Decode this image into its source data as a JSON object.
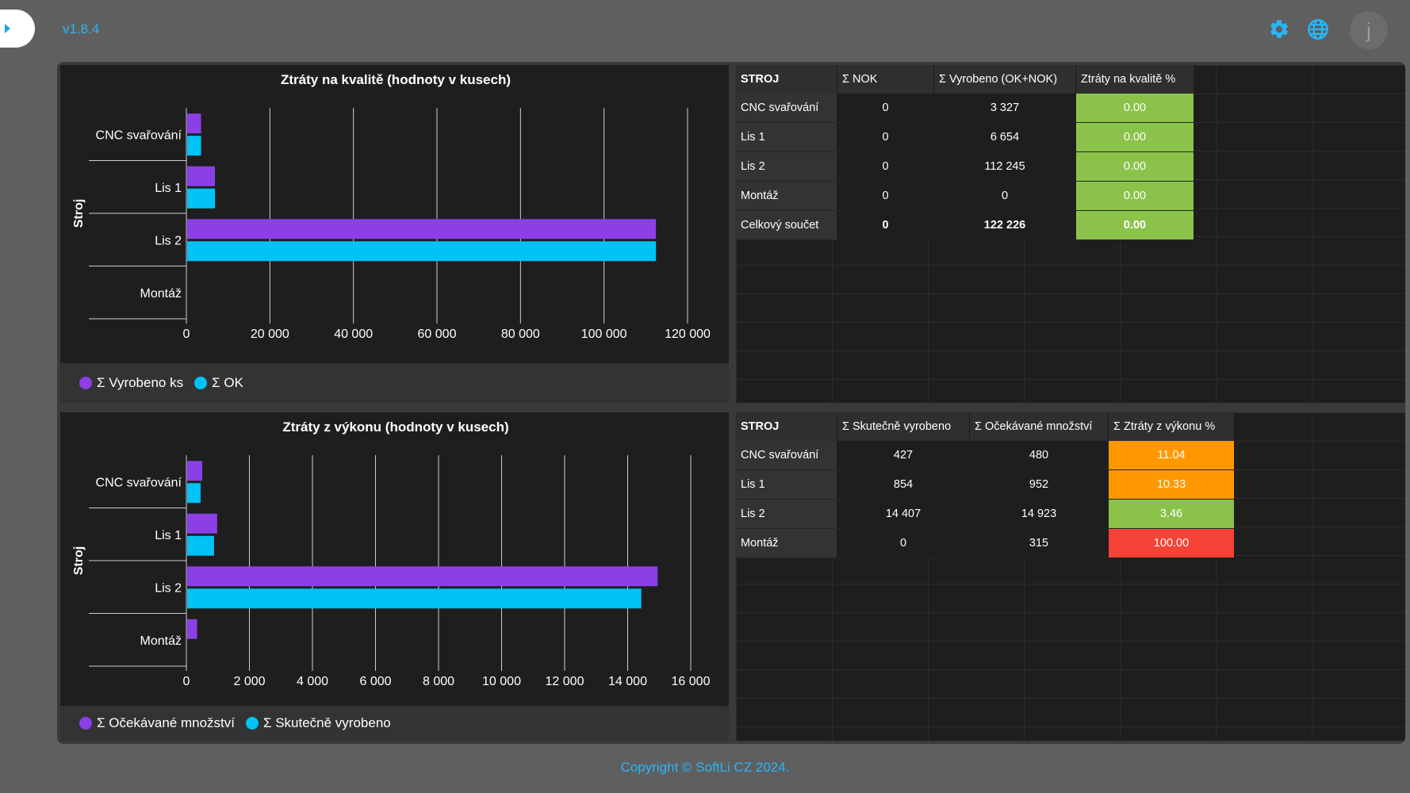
{
  "header": {
    "version": "v1.8.4",
    "avatar_letter": "j"
  },
  "charts": [
    {
      "title": "Ztráty na kvalitě (hodnoty v kusech)",
      "ylabel": "Stroj",
      "categories": [
        "CNC svařování",
        "Lis 1",
        "Lis 2",
        "Montáž"
      ],
      "xmax": 120000,
      "ticks": [
        0,
        20000,
        40000,
        60000,
        80000,
        100000,
        120000
      ],
      "series": [
        {
          "name": "Σ Vyrobeno ks",
          "color": "#8c3fe6",
          "values": [
            3327,
            6654,
            112245,
            0
          ]
        },
        {
          "name": "Σ OK",
          "color": "#00c2f5",
          "values": [
            3327,
            6654,
            112245,
            0
          ]
        }
      ]
    },
    {
      "title": "Ztráty z výkonu (hodnoty v kusech)",
      "ylabel": "Stroj",
      "categories": [
        "CNC svařování",
        "Lis 1",
        "Lis 2",
        "Montáž"
      ],
      "xmax": 16000,
      "ticks": [
        0,
        2000,
        4000,
        6000,
        8000,
        10000,
        12000,
        14000,
        16000
      ],
      "series": [
        {
          "name": "Σ Očekávané množství",
          "color": "#8c3fe6",
          "values": [
            480,
            952,
            14923,
            315
          ]
        },
        {
          "name": "Σ Skutečně vyrobeno",
          "color": "#00c2f5",
          "values": [
            427,
            854,
            14407,
            0
          ]
        }
      ]
    }
  ],
  "quality_table": {
    "headers": [
      "STROJ",
      "Σ NOK",
      "Σ Vyrobeno (OK+NOK)",
      "Ztráty na kvalitě %"
    ],
    "rows": [
      {
        "name": "CNC svařování",
        "nok": "0",
        "produced": "3 327",
        "pct": "0.00",
        "color": "#8bc34a"
      },
      {
        "name": "Lis 1",
        "nok": "0",
        "produced": "6 654",
        "pct": "0.00",
        "color": "#8bc34a"
      },
      {
        "name": "Lis 2",
        "nok": "0",
        "produced": "112 245",
        "pct": "0.00",
        "color": "#8bc34a"
      },
      {
        "name": "Montáž",
        "nok": "0",
        "produced": "0",
        "pct": "0.00",
        "color": "#8bc34a"
      },
      {
        "name": "Celkový součet",
        "nok": "0",
        "produced": "122 226",
        "pct": "0.00",
        "color": "#8bc34a"
      }
    ]
  },
  "performance_table": {
    "headers": [
      "STROJ",
      "Σ Skutečně vyrobeno",
      "Σ Očekávané množství",
      "Σ Ztráty z výkonu %"
    ],
    "rows": [
      {
        "name": "CNC svařování",
        "actual": "427",
        "expected": "480",
        "pct": "11.04",
        "color": "#ff9800"
      },
      {
        "name": "Lis 1",
        "actual": "854",
        "expected": "952",
        "pct": "10.33",
        "color": "#ff9800"
      },
      {
        "name": "Lis 2",
        "actual": "14 407",
        "expected": "14 923",
        "pct": "3.46",
        "color": "#8bc34a"
      },
      {
        "name": "Montáž",
        "actual": "0",
        "expected": "315",
        "pct": "100.00",
        "color": "#f44336"
      }
    ]
  },
  "footer": {
    "copyright": "Copyright © SoftLi CZ 2024."
  }
}
